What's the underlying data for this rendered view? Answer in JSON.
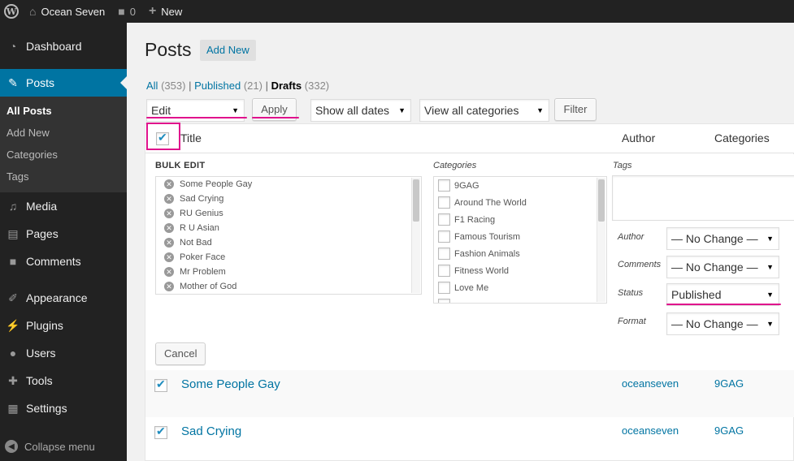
{
  "adminbar": {
    "site_name": "Ocean Seven",
    "comments_count": "0",
    "new_label": "New"
  },
  "sidebar": {
    "items": [
      {
        "label": "Dashboard",
        "icon": "dashboard-icon"
      },
      {
        "label": "Posts",
        "icon": "pin-icon"
      },
      {
        "label": "Media",
        "icon": "media-icon"
      },
      {
        "label": "Pages",
        "icon": "pages-icon"
      },
      {
        "label": "Comments",
        "icon": "comment-icon"
      },
      {
        "label": "Appearance",
        "icon": "brush-icon"
      },
      {
        "label": "Plugins",
        "icon": "plugin-icon"
      },
      {
        "label": "Users",
        "icon": "user-icon"
      },
      {
        "label": "Tools",
        "icon": "wrench-icon"
      },
      {
        "label": "Settings",
        "icon": "settings-icon"
      }
    ],
    "posts_submenu": [
      "All Posts",
      "Add New",
      "Categories",
      "Tags"
    ],
    "collapse_label": "Collapse menu"
  },
  "page": {
    "title": "Posts",
    "add_new": "Add New"
  },
  "views": {
    "all_label": "All",
    "all_count": "(353)",
    "published_label": "Published",
    "published_count": "(21)",
    "drafts_label": "Drafts",
    "drafts_count": "(332)",
    "separator": "|"
  },
  "toolbar": {
    "bulk_action": "Edit",
    "apply": "Apply",
    "dates": "Show all dates",
    "categories": "View all categories",
    "filter": "Filter"
  },
  "table": {
    "col_title": "Title",
    "col_author": "Author",
    "col_categories": "Categories"
  },
  "bulk_edit": {
    "heading": "BULK EDIT",
    "titles": [
      "Some People Gay",
      "Sad Crying",
      "RU Genius",
      "R U Asian",
      "Not Bad",
      "Poker Face",
      "Mr Problem",
      "Mother of God"
    ],
    "categories_label": "Categories",
    "categories": [
      "9GAG",
      "Around The World",
      "F1 Racing",
      "Famous Tourism",
      "Fashion Animals",
      "Fitness World",
      "Love Me"
    ],
    "tags_label": "Tags",
    "author_label": "Author",
    "author_value": "— No Change —",
    "comments_label": "Comments",
    "comments_value": "— No Change —",
    "status_label": "Status",
    "status_value": "Published",
    "format_label": "Format",
    "format_value": "— No Change —",
    "cancel": "Cancel"
  },
  "rows": [
    {
      "title": "Some People Gay",
      "author": "oceanseven",
      "category": "9GAG",
      "checked": true
    },
    {
      "title": "Sad Crying",
      "author": "oceanseven",
      "category": "9GAG",
      "checked": true
    }
  ],
  "colors": {
    "accent": "#0074a2",
    "annotation": "#e0128c",
    "sidebar_bg": "#222222"
  }
}
